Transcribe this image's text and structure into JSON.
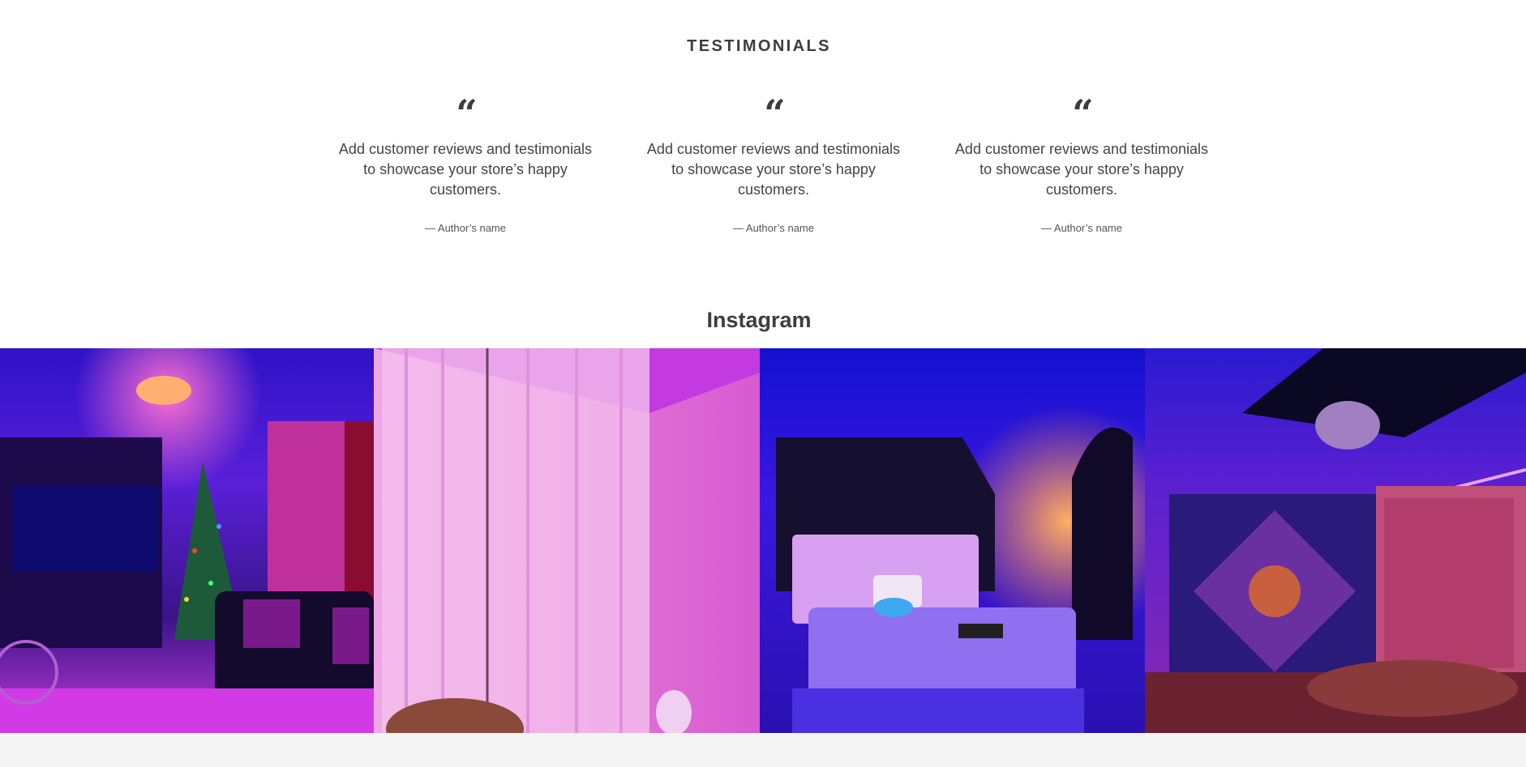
{
  "testimonials": {
    "heading": "TESTIMONIALS",
    "items": [
      {
        "quote_icon": "“",
        "text": "Add customer reviews and testimonials to showcase your store’s happy customers.",
        "author": "— Author’s name"
      },
      {
        "quote_icon": "“",
        "text": "Add customer reviews and testimonials to showcase your store’s happy customers.",
        "author": "— Author’s name"
      },
      {
        "quote_icon": "“",
        "text": "Add customer reviews and testimonials to showcase your store’s happy customers.",
        "author": "— Author’s name"
      }
    ]
  },
  "instagram": {
    "heading": "Instagram",
    "posts": [
      {
        "icon": "instagram-photo-galaxy-living-room",
        "accent": "#3a1fd1"
      },
      {
        "icon": "instagram-photo-pink-curtains",
        "accent": "#e070e0"
      },
      {
        "icon": "instagram-photo-bedroom-star-ceiling",
        "accent": "#2a20e8"
      },
      {
        "icon": "instagram-photo-tapestry-room",
        "accent": "#7a2cc8"
      }
    ]
  },
  "colors": {
    "heading_text": "#3d3d3d",
    "footer_band": "#f4f4f4"
  }
}
